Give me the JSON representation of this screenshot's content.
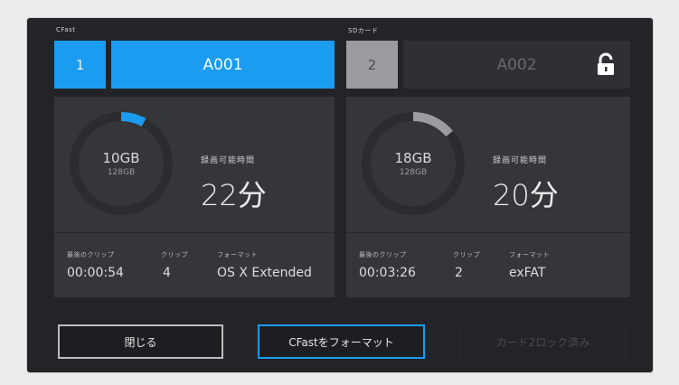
{
  "cards": {
    "left": {
      "label": "CFast",
      "slot_number": "1",
      "clip_name": "A001",
      "used": "10GB",
      "total": "128GB",
      "remaining_label": "録画可能時間",
      "remaining_value": "22分",
      "usage_fraction": 0.08,
      "meta_labels": [
        "最後のクリップ",
        "クリップ",
        "フォーマット"
      ],
      "last_clip": "00:00:54",
      "clips": "4",
      "format": "OS X Extended",
      "accent": "#1a9df0"
    },
    "right": {
      "label": "SDカード",
      "slot_number": "2",
      "clip_name": "A002",
      "used": "18GB",
      "total": "128GB",
      "remaining_label": "録画可能時間",
      "remaining_value": "20分",
      "usage_fraction": 0.14,
      "locked": true,
      "meta_labels": [
        "最後のクリップ",
        "クリップ",
        "フォーマット"
      ],
      "last_clip": "00:03:26",
      "clips": "2",
      "format": "exFAT",
      "accent": "#9a9c9f"
    }
  },
  "buttons": {
    "close": "閉じる",
    "format": "CFastをフォーマット",
    "lock_card": "カード2ロック済み"
  },
  "icons": {
    "lock": "unlocked-padlock-icon"
  }
}
